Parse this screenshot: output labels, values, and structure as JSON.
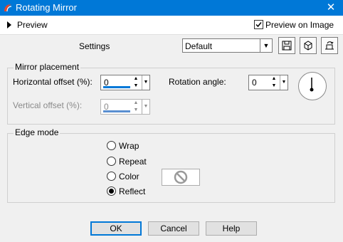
{
  "window": {
    "title": "Rotating Mirror",
    "close_glyph": "✕"
  },
  "toolbar": {
    "preview_label": "Preview",
    "preview_on_image_label": "Preview on Image",
    "preview_on_image_checked": true
  },
  "settings": {
    "label": "Settings",
    "preset_value": "Default",
    "icons": [
      "save-preset-icon",
      "load-preset-icon",
      "reset-preset-icon"
    ]
  },
  "mirror_placement": {
    "legend": "Mirror placement",
    "horizontal_offset_label": "Horizontal offset (%):",
    "horizontal_offset_value": "0",
    "vertical_offset_label": "Vertical offset (%):",
    "vertical_offset_value": "0",
    "rotation_angle_label": "Rotation angle:",
    "rotation_angle_value": "0"
  },
  "edge_mode": {
    "legend": "Edge mode",
    "options": [
      "Wrap",
      "Repeat",
      "Color",
      "Reflect"
    ],
    "selected": "Reflect",
    "color_swatch_icon": "no-color-icon"
  },
  "buttons": {
    "ok": "OK",
    "cancel": "Cancel",
    "help": "Help"
  },
  "colors": {
    "accent": "#0078d7",
    "panel_bg": "#f0f0f0"
  }
}
